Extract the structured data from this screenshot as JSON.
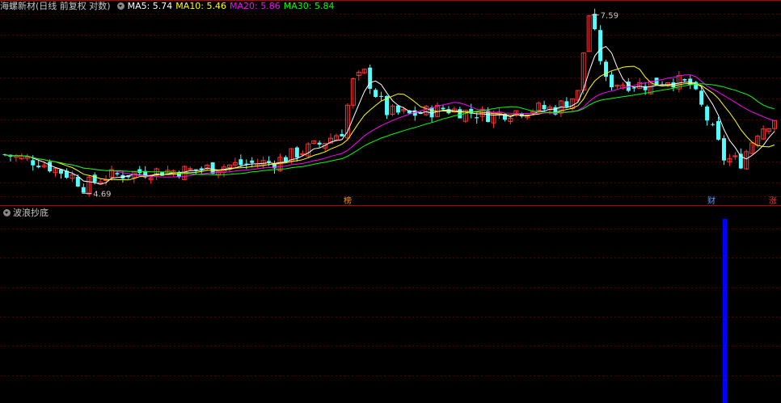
{
  "title": "海螺新材(日线 前复权 对数)",
  "ma_labels": [
    {
      "text": "MA5: 5.74",
      "color": "#ffffff"
    },
    {
      "text": "MA10: 5.46",
      "color": "#ffff00"
    },
    {
      "text": "MA20: 5.86",
      "color": "#ff00ff"
    },
    {
      "text": "MA30: 5.84",
      "color": "#00ff00"
    }
  ],
  "indicator_title": "波浪抄底",
  "markers": {
    "high_label": "7.59",
    "low_label": "4.69",
    "event_1": "榜",
    "event_2": "财",
    "event_3": "涨"
  },
  "colors": {
    "up": "#ff3232",
    "down": "#54fcfc",
    "grid": "#5a0000",
    "separator": "#b40000",
    "signal": "#0000ff"
  },
  "chart_data": {
    "type": "candlestick",
    "title": "海螺新材(日线 前复权 对数)",
    "price_range_approx": [
      4.6,
      7.7
    ],
    "highest": 7.59,
    "lowest": 4.69,
    "ma_last": {
      "MA5": 5.74,
      "MA10": 5.46,
      "MA20": 5.86,
      "MA30": 5.84
    }
  }
}
